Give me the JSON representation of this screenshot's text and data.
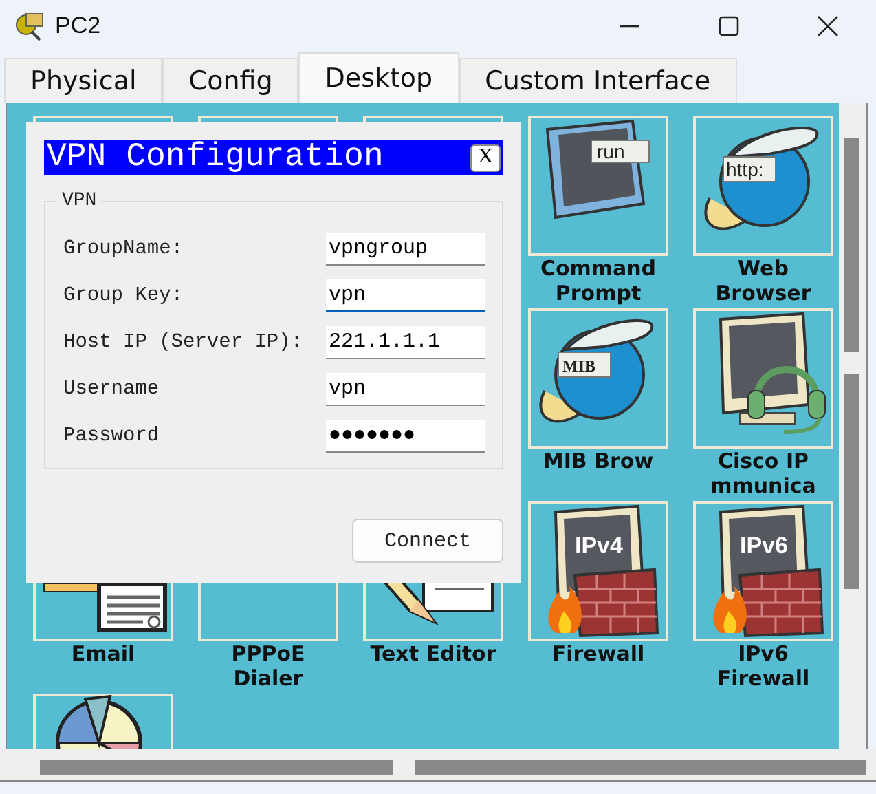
{
  "window": {
    "title": "PC2"
  },
  "tabs": [
    {
      "label": "Physical",
      "selected": false
    },
    {
      "label": "Config",
      "selected": false
    },
    {
      "label": "Desktop",
      "selected": true
    },
    {
      "label": "Custom Interface",
      "selected": false
    }
  ],
  "desktop": {
    "rows": [
      [
        {
          "kind": "empty"
        },
        {
          "kind": "empty"
        },
        {
          "kind": "empty"
        },
        {
          "kind": "terminal",
          "icon_text": "run",
          "label": "Command Prompt"
        },
        {
          "kind": "browser",
          "icon_text": "http:",
          "label": "Web Browser"
        }
      ],
      [
        "",
        "",
        "",
        {
          "kind": "mib",
          "icon_text": "MIB",
          "label": "MIB Brow"
        },
        {
          "kind": "headset",
          "label": "Cisco IP mmunica"
        }
      ],
      [
        {
          "kind": "email",
          "label": "Email"
        },
        {
          "kind": "empty",
          "label": "PPPoE Dialer"
        },
        {
          "kind": "editor",
          "label": "Text Editor"
        },
        {
          "kind": "firewall",
          "icon_text": "IPv4",
          "label": "Firewall"
        },
        {
          "kind": "firewall",
          "icon_text": "IPv6",
          "label": "IPv6 Firewall"
        }
      ],
      [
        {
          "kind": "chart"
        }
      ]
    ]
  },
  "dialog": {
    "title": "VPN Configuration",
    "close": "X",
    "group": "VPN",
    "fields": [
      {
        "label": "GroupName:",
        "value": "vpngroup",
        "focused": false
      },
      {
        "label": "Group Key:",
        "value": "vpn",
        "focused": true
      },
      {
        "label": "Host IP (Server IP):",
        "value": "221.1.1.1",
        "focused": false
      },
      {
        "label": "Username",
        "value": "vpn",
        "focused": false
      },
      {
        "label": "Password",
        "value": "●●●●●●●",
        "focused": false
      }
    ],
    "button": "Connect"
  }
}
